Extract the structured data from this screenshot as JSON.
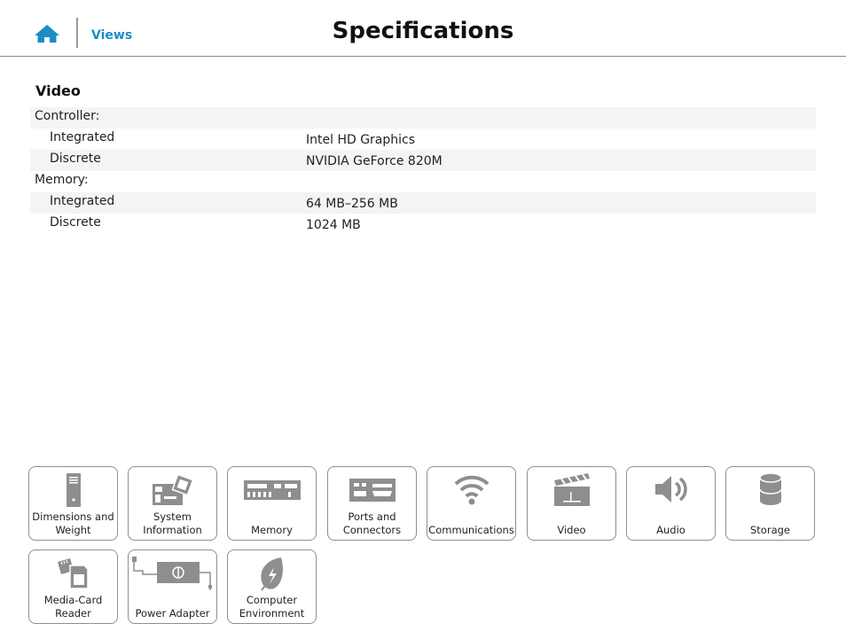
{
  "header": {
    "home_icon": "home-icon",
    "views_link": "Views",
    "title": "Specifications"
  },
  "section": {
    "title": "Video",
    "rows": [
      {
        "label": "Controller:",
        "value": ""
      },
      {
        "label": "Integrated",
        "value": "Intel HD Graphics"
      },
      {
        "label": "Discrete",
        "value": "NVIDIA GeForce 820M"
      },
      {
        "label": "Memory:",
        "value": ""
      },
      {
        "label": "Integrated",
        "value": "64 MB–256 MB"
      },
      {
        "label": "Discrete",
        "value": "1024 MB"
      }
    ]
  },
  "nav_tiles": [
    {
      "label": "Dimensions and Weight",
      "icon": "tower-icon"
    },
    {
      "label": "System Information",
      "icon": "motherboard-icon"
    },
    {
      "label": "Memory",
      "icon": "memory-module-icon"
    },
    {
      "label": "Ports and Connectors",
      "icon": "ports-icon"
    },
    {
      "label": "Communications",
      "icon": "wifi-icon"
    },
    {
      "label": "Video",
      "icon": "clapperboard-icon"
    },
    {
      "label": "Audio",
      "icon": "speaker-icon"
    },
    {
      "label": "Storage",
      "icon": "storage-cylinder-icon"
    },
    {
      "label": "Media-Card Reader",
      "icon": "media-card-icon"
    },
    {
      "label": "Power Adapter",
      "icon": "power-adapter-icon"
    },
    {
      "label": "Computer Environment",
      "icon": "leaf-icon"
    }
  ],
  "colors": {
    "link": "#1a8dc7",
    "icon_gray": "#8e8e8e",
    "row_shade": "#f4f4f4"
  }
}
